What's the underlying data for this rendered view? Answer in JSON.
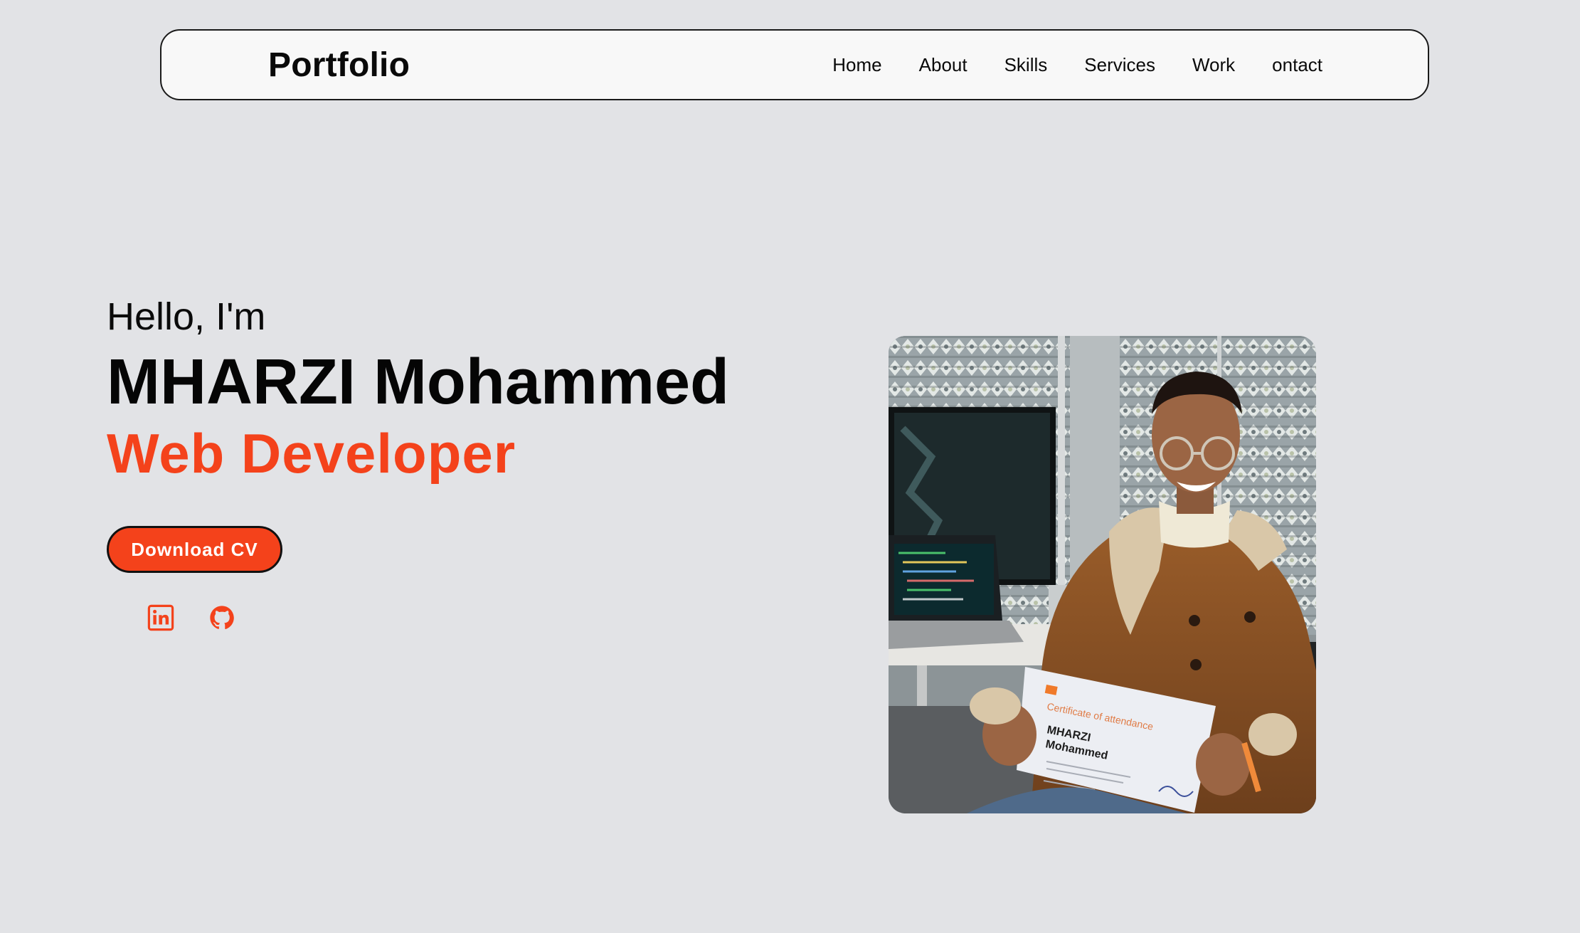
{
  "header": {
    "logo": "Portfolio",
    "nav": [
      {
        "label": "Home"
      },
      {
        "label": "About"
      },
      {
        "label": "Skills"
      },
      {
        "label": "Services"
      },
      {
        "label": "Work"
      },
      {
        "label": "ontact"
      }
    ]
  },
  "hero": {
    "greeting": "Hello, I'm",
    "name": "MHARZI Mohammed",
    "role": "Web Developer",
    "cta_label": "Download CV",
    "social": [
      {
        "icon": "linkedin-icon"
      },
      {
        "icon": "github-icon"
      }
    ]
  },
  "photo": {
    "certificate_title": "Certificate of attendance",
    "certificate_name_line1": "MHARZI",
    "certificate_name_line2": "Mohammed"
  },
  "colors": {
    "background": "#e2e3e6",
    "accent": "#f4421b",
    "text": "#0a0a0a",
    "nav_background": "#f8f8f8"
  }
}
